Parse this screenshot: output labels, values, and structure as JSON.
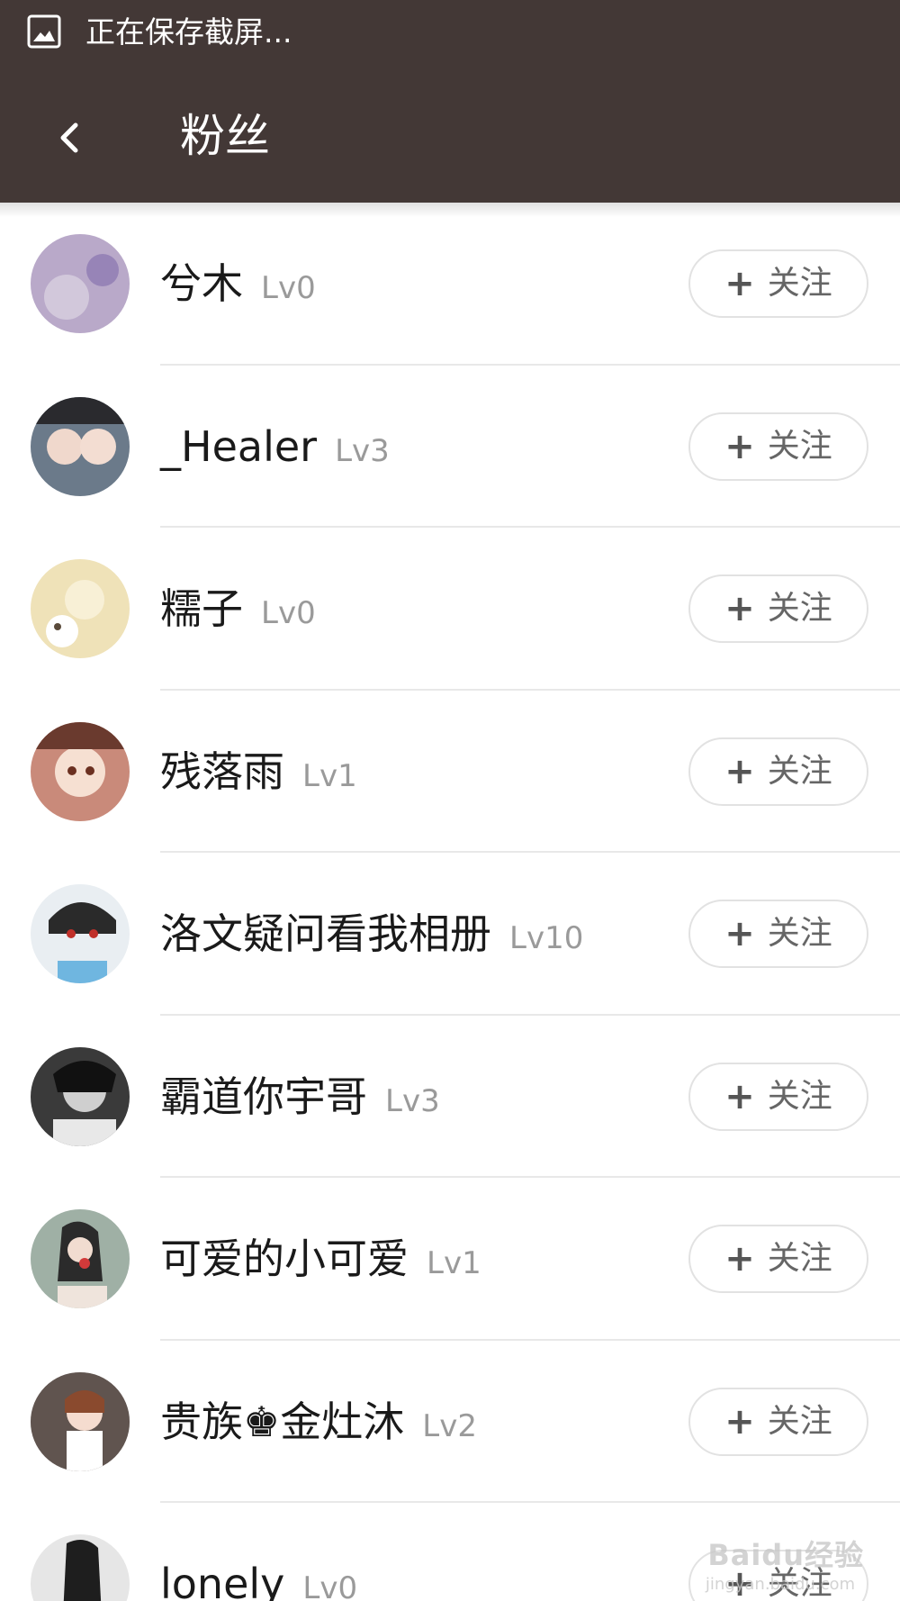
{
  "status_bar": {
    "icon": "screenshot-image-icon",
    "text": "正在保存截屏..."
  },
  "header": {
    "back_icon": "chevron-left-icon",
    "title": "粉丝"
  },
  "follow_label": "关注",
  "plus_glyph": "+",
  "fans": [
    {
      "name": "兮木",
      "level": "Lv0",
      "avatar_color": "#b9a9c9"
    },
    {
      "name": "_Healer",
      "level": "Lv3",
      "avatar_color": "#6b7a8a"
    },
    {
      "name": "糯子",
      "level": "Lv0",
      "avatar_color": "#efe2b8"
    },
    {
      "name": "残落雨",
      "level": "Lv1",
      "avatar_color": "#c98a7a"
    },
    {
      "name": "洛文‌疑问看我相册",
      "level": "Lv10",
      "avatar_color": "#e9eef2"
    },
    {
      "name": "霸道你宇哥",
      "level": "Lv3",
      "avatar_color": "#3a3a3a"
    },
    {
      "name": "可爱的小可爱",
      "level": "Lv1",
      "avatar_color": "#9fb0a5"
    },
    {
      "name": "贵族♚金灶沐",
      "level": "Lv2",
      "avatar_color": "#6e5a52"
    },
    {
      "name": "lonely",
      "level": "Lv0",
      "avatar_color": "#e6e6e6"
    }
  ],
  "watermark": {
    "main": "Baidu经验",
    "sub": "jingyan.baidu.com"
  }
}
